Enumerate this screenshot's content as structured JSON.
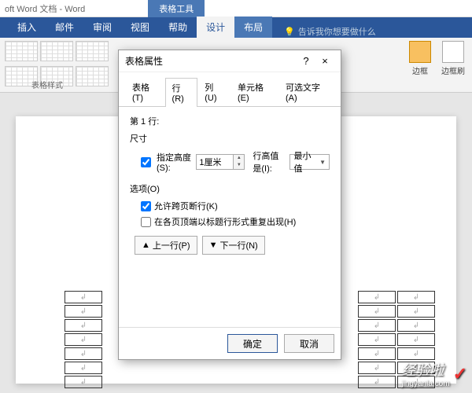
{
  "titlebar": "oft Word 文档 - Word",
  "context_tab_group": "表格工具",
  "ribbon_tabs": [
    "插入",
    "邮件",
    "审阅",
    "视图",
    "帮助",
    "设计",
    "布局"
  ],
  "ribbon_active_index": 5,
  "tellme": {
    "placeholder": "告诉我你想要做什么",
    "icon": "bulb-icon"
  },
  "ribbon": {
    "styles_group_label": "表格样式",
    "border_style_label": "边框",
    "border_painter_label": "边框刷"
  },
  "dialog": {
    "title": "表格属性",
    "help": "?",
    "close": "×",
    "tabs": [
      "表格(T)",
      "行(R)",
      "列(U)",
      "单元格(E)",
      "可选文字(A)"
    ],
    "active_tab": 1,
    "row_label": "第 1 行:",
    "size_label": "尺寸",
    "specify_height": {
      "checked": true,
      "label": "指定高度(S):"
    },
    "height_value": "1厘米",
    "row_height_is_label": "行高值是(I):",
    "row_height_is_value": "最小值",
    "options_label": "选项(O)",
    "allow_break": {
      "checked": true,
      "label": "允许跨页断行(K)"
    },
    "repeat_header": {
      "checked": false,
      "label": "在各页顶端以标题行形式重复出现(H)"
    },
    "prev_row": "上一行(P)",
    "next_row": "下一行(N)",
    "ok": "确定",
    "cancel": "取消"
  },
  "table_cell_placeholder": "↲",
  "watermark": {
    "brand": "经验啦",
    "url": "jingyanla.com",
    "check": "✓"
  }
}
